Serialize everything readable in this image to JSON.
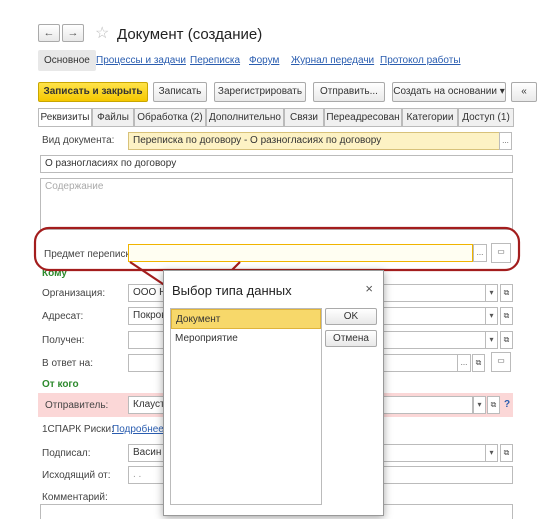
{
  "window": {
    "title": "Документ (создание)"
  },
  "nav": {
    "back": "←",
    "forward": "→",
    "star": "☆"
  },
  "toplinks": [
    "Основное",
    "Процессы и задачи",
    "Переписка",
    "Форум",
    "Журнал передачи",
    "Протокол работы"
  ],
  "toolbar": {
    "save_close": "Записать и закрыть",
    "save": "Записать",
    "register": "Зарегистрировать",
    "send": "Отправить...",
    "create_based": "Создать на основании",
    "extra": "«"
  },
  "tabs": [
    "Реквизиты",
    "Файлы",
    "Обработка (2)",
    "Дополнительно",
    "Связи",
    "Переадресован",
    "Категории",
    "Доступ (1)"
  ],
  "form": {
    "doc_type_label": "Вид документа:",
    "doc_type_value": "Переписка по договору - О разногласиях по договору",
    "subject_value": "О разногласиях по договору",
    "content_placeholder": "Содержание",
    "correspondence_label": "Предмет переписки:",
    "section_to": "Кому",
    "org_label": "Организация:",
    "org_value": "ООО Н",
    "addressee_label": "Адресат:",
    "addressee_value": "Покров",
    "received_label": "Получен:",
    "reply_label": "В ответ на:",
    "section_from": "От кого",
    "sender_label": "Отправитель:",
    "sender_value": "Клауст",
    "spark_label": "1СПАРК Риски:",
    "spark_link": "Подробнее с",
    "signed_label": "Подписал:",
    "signed_value": "Васин",
    "outgoing_label": "Исходящий от:",
    "outgoing_value": ". .",
    "comment_label": "Комментарий:",
    "question": "?"
  },
  "modal": {
    "title": "Выбор типа данных",
    "close": "×",
    "items": [
      "Документ",
      "Мероприятие"
    ],
    "ok": "OK",
    "cancel": "Отмена"
  },
  "colors": {
    "annotation": "#a31d1d",
    "accent_yellow": "#f6c800",
    "section_green": "#2d8a2d"
  }
}
